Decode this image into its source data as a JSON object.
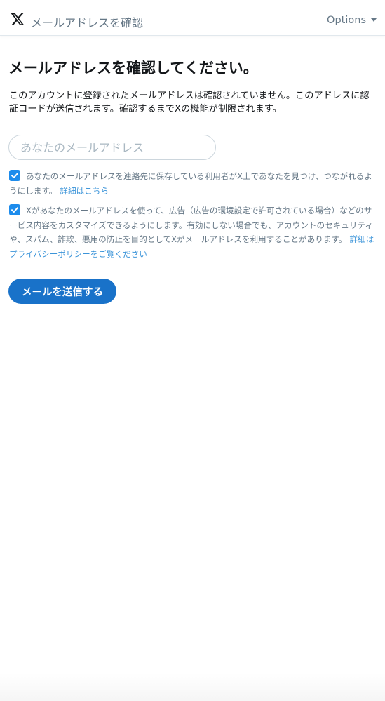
{
  "header": {
    "title": "メールアドレスを確認",
    "options_label": "Options",
    "logo_icon": "x-logo-icon"
  },
  "main": {
    "page_title": "メールアドレスを確認してください。",
    "intro_text": "このアカウントに登録されたメールアドレスは確認されていません。このアドレスに認証コードが送信されます。確認するまでXの機能が制限されます。",
    "email_input": {
      "value": "",
      "placeholder": "あなたのメールアドレス"
    },
    "consent_discoverable": {
      "checked": true,
      "text": "あなたのメールアドレスを連絡先に保存している利用者がX上であなたを見つけ、つながれるようにします。",
      "link_label": "詳細はこちら"
    },
    "consent_personalization": {
      "checked": true,
      "text": "Xがあなたのメールアドレスを使って、広告（広告の環境設定で許可されている場合）などのサービス内容をカスタマイズできるようにします。有効にしない場合でも、アカウントのセキュリティや、スパム、詐欺、悪用の防止を目的としてXがメールアドレスを利用することがあります。",
      "link_label": "詳細はプライバシーポリシーをご覧ください"
    },
    "send_button_label": "メールを送信する"
  },
  "colors": {
    "accent": "#1972c9",
    "checkbox": "#1d8cec",
    "link": "#3b94d9",
    "muted_text": "#657786"
  }
}
